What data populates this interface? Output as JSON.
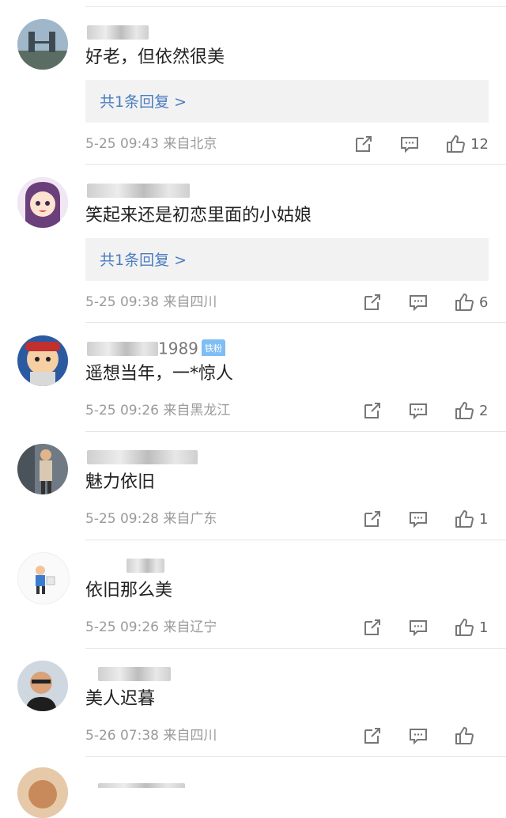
{
  "comments": [
    {
      "name": "",
      "text": "好老，但依然很美",
      "reply": "共1条回复 >",
      "time": "5-25 09:43",
      "location": "来自北京",
      "likes": "12"
    },
    {
      "name": "",
      "text": "笑起来还是初恋里面的小姑娘",
      "reply": "共1条回复 >",
      "time": "5-25 09:38",
      "location": "来自四川",
      "likes": "6"
    },
    {
      "name": "1989",
      "badge": "铁粉",
      "text": "遥想当年，一*惊人",
      "time": "5-25 09:26",
      "location": "来自黑龙江",
      "likes": "2"
    },
    {
      "name": "",
      "text": "魅力依旧",
      "time": "5-25 09:28",
      "location": "来自广东",
      "likes": "1"
    },
    {
      "name": "",
      "text": "依旧那么美",
      "time": "5-25 09:26",
      "location": "来自辽宁",
      "likes": "1"
    },
    {
      "name": "",
      "text": "美人迟暮",
      "time": "5-26 07:38",
      "location": "来自四川",
      "likes": ""
    }
  ],
  "icons": {
    "share": "share-icon",
    "comment": "comment-icon",
    "like": "thumbs-up-icon"
  }
}
